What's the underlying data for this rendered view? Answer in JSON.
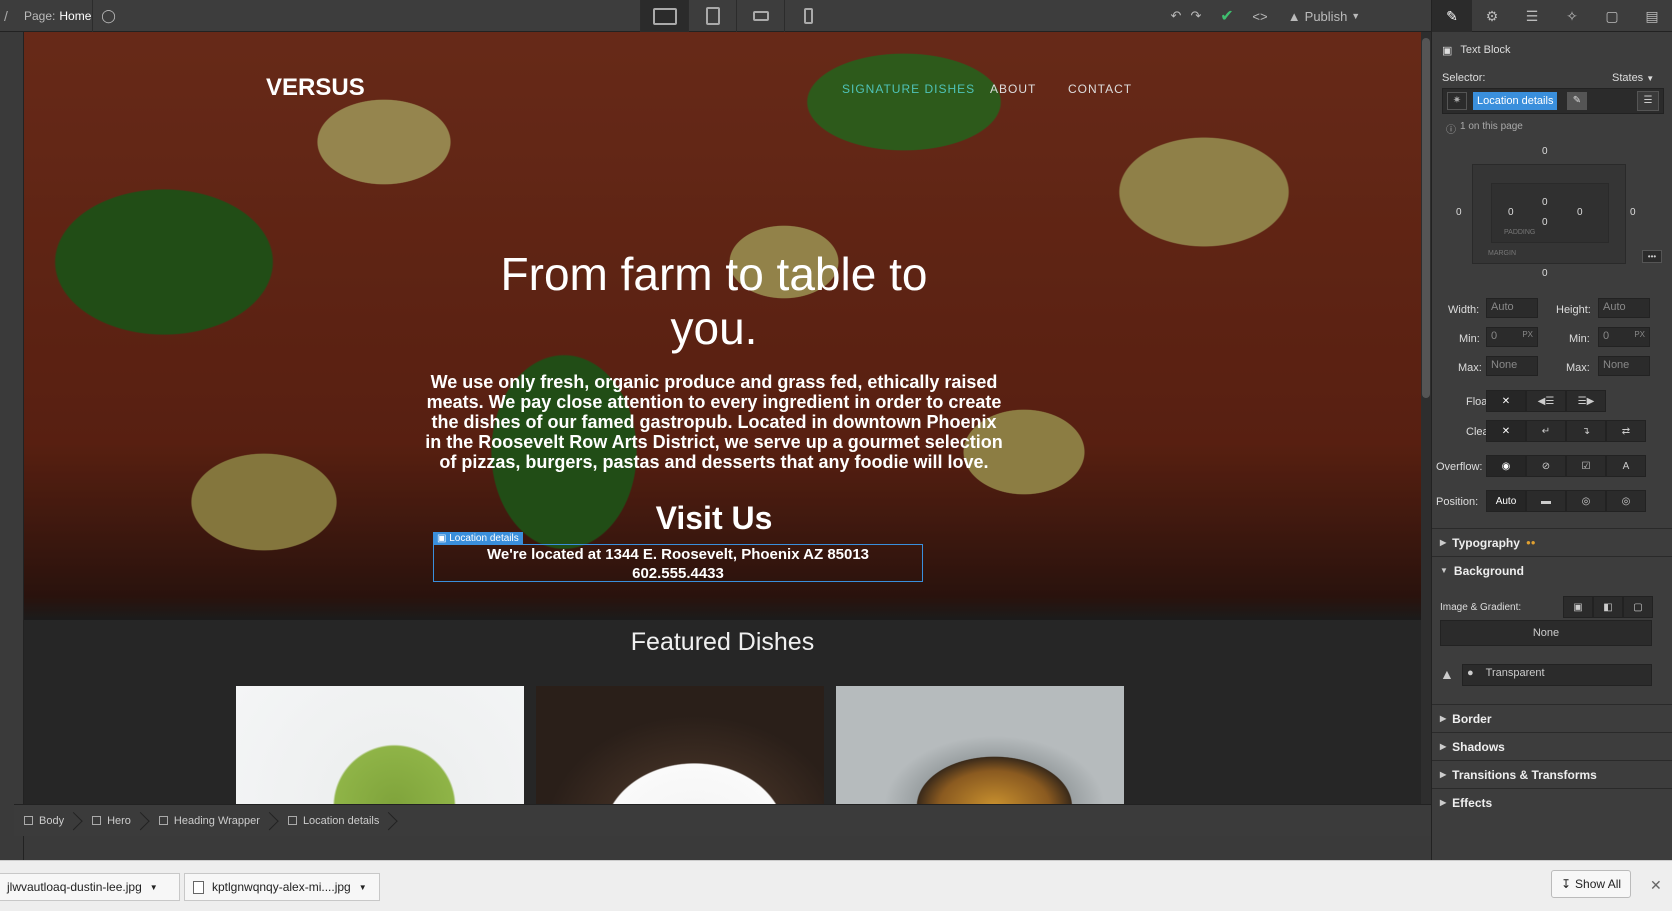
{
  "topbar": {
    "page_prefix": "Page:",
    "page_name": "Home",
    "publish_label": "Publish",
    "devices": [
      "desktop-icon",
      "tablet-icon",
      "phone-landscape-icon",
      "phone-portrait-icon"
    ]
  },
  "site": {
    "logo": "VERSUS",
    "nav": [
      "SIGNATURE DISHES",
      "ABOUT",
      "CONTACT"
    ],
    "nav_active_color": "#4fc3b8",
    "hero_title": "From farm to table to you.",
    "hero_body": "We use only fresh, organic produce and grass fed, ethically raised meats. We pay close attention to every ingredient in order to create the dishes of our famed gastropub. Located in downtown Phoenix in the Roosevelt Row Arts District, we serve up a gourmet selection of pizzas, burgers, pastas and desserts that any foodie will love.",
    "visit_heading": "Visit Us",
    "location_tag": "Location details",
    "location_line1": "We're located at 1344 E. Roosevelt, Phoenix AZ 85013",
    "location_line2": "602.555.4433",
    "featured_heading": "Featured Dishes",
    "dishes": [
      "pasta-salad-image",
      "dessert-image",
      "chicken-dish-image"
    ]
  },
  "breadcrumbs": [
    "Body",
    "Hero",
    "Heading Wrapper",
    "Location details"
  ],
  "panel": {
    "element_type": "Text Block",
    "selector_label": "Selector:",
    "states_label": "States",
    "selector_value": "Location details",
    "on_page": "1 on this page",
    "box_values": {
      "margin_top": "0",
      "margin_bottom": "0",
      "margin_left": "0",
      "margin_right": "0",
      "padding_top": "0",
      "padding_bottom": "0",
      "padding_left": "0",
      "padding_right": "0"
    },
    "padding_label": "PADDING",
    "margin_label": "MARGIN",
    "width_label": "Width:",
    "width_value": "Auto",
    "height_label": "Height:",
    "height_value": "Auto",
    "min_label": "Min:",
    "min_value": "0",
    "min_unit": "PX",
    "max_label": "Max:",
    "max_value": "None",
    "float_label": "Float:",
    "clear_label": "Clear:",
    "overflow_label": "Overflow:",
    "position_label": "Position:",
    "position_value": "Auto",
    "typography": "Typography",
    "background": "Background",
    "image_gradient": "Image & Gradient:",
    "image_none": "None",
    "bg_color": "Transparent",
    "border": "Border",
    "shadows": "Shadows",
    "transitions": "Transitions & Transforms",
    "effects": "Effects"
  },
  "downloads": {
    "file1": "jlwvautloaq-dustin-lee.jpg",
    "file2": "kptlgnwqnqy-alex-mi....jpg",
    "show_all": "Show All"
  },
  "colors": {
    "accent": "#3a8fdc",
    "publish_check": "#3fbf6f"
  }
}
